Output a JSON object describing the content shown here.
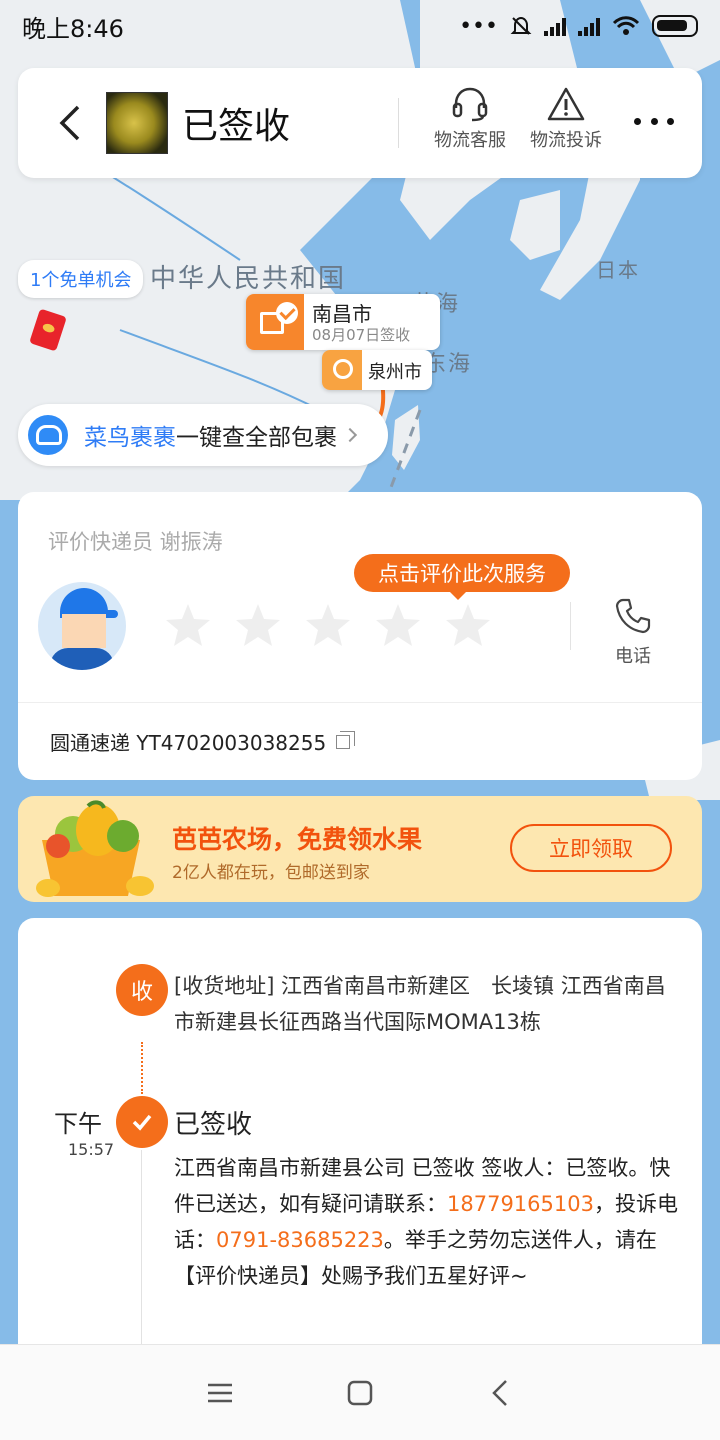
{
  "status_bar": {
    "time": "晚上8:46"
  },
  "header": {
    "title": "已签收",
    "actions": {
      "service": "物流客服",
      "complaint": "物流投诉"
    }
  },
  "map": {
    "country_label": "中华人民共和国",
    "japan_label": "日本",
    "sea_label": "东海",
    "yellow_label": "黄海",
    "free_chance": "1个免单机会",
    "destination": {
      "city": "南昌市",
      "sub": "08月07日签收"
    },
    "origin": {
      "city": "泉州市"
    },
    "cainiao": {
      "brand": "菜鸟裹裹",
      "text": "一键查全部包裹"
    }
  },
  "rating": {
    "title": "评价快递员 谢振涛",
    "tip": "点击评价此次服务",
    "stars_total": 5,
    "stars_filled": 0,
    "phone_label": "电话",
    "tracking_text": "圆通速递 YT4702003038255"
  },
  "promo": {
    "title": "芭芭农场，免费领水果",
    "sub": "2亿人都在玩，包邮送到家",
    "button": "立即领取"
  },
  "timeline": {
    "addr_node": "收",
    "address": "[收货地址] 江西省南昌市新建区　长堎镇 江西省南昌市新建县长征西路当代国际MOMA13栋",
    "day": "下午",
    "time": "15:57",
    "status": "已签收",
    "detail_part1": "江西省南昌市新建县公司 已签收 签收人：已签收。快件已送达，如有疑问请联系：",
    "phone1": "18779165103",
    "detail_part2": "，投诉电话：",
    "phone2": "0791-83685223",
    "detail_part3": "。举手之劳勿忘送件人，请在【评价快递员】处赐予我们五星好评~"
  },
  "colors": {
    "accent": "#f46e1b",
    "brand_blue": "#2f7cf6"
  }
}
